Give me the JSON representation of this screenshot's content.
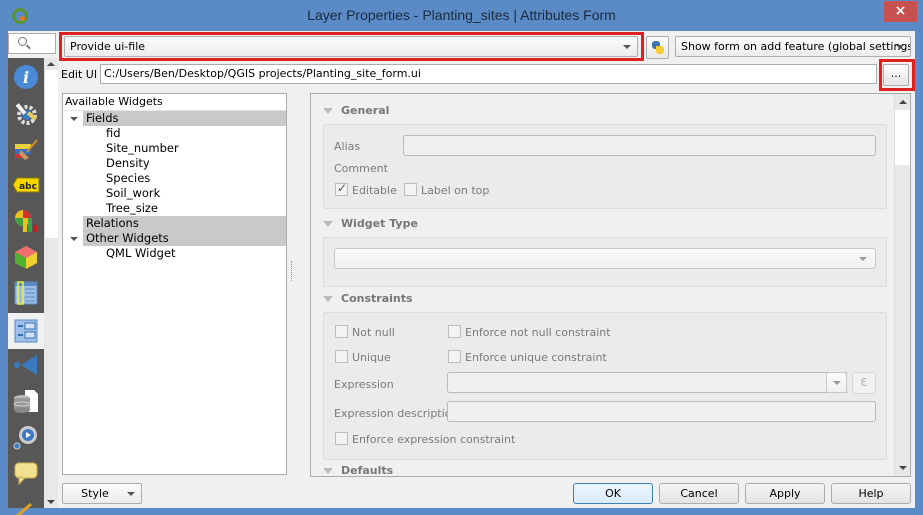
{
  "window": {
    "title": "Layer Properties - Planting_sites | Attributes Form",
    "close_label": "×"
  },
  "sidebar": {
    "search_icon": "search-icon",
    "items": [
      {
        "name": "information",
        "icon": "info-icon"
      },
      {
        "name": "source",
        "icon": "settings-wrench-icon"
      },
      {
        "name": "symbology",
        "icon": "paintbrush-icon"
      },
      {
        "name": "labels",
        "icon": "abc-label-icon"
      },
      {
        "name": "diagrams",
        "icon": "diagram-icon"
      },
      {
        "name": "3d-view",
        "icon": "cube-icon"
      },
      {
        "name": "fields",
        "icon": "fields-table-icon"
      },
      {
        "name": "attributes-form",
        "icon": "form-icon",
        "active": true
      },
      {
        "name": "joins",
        "icon": "join-icon"
      },
      {
        "name": "auxiliary-storage",
        "icon": "database-icon"
      },
      {
        "name": "actions",
        "icon": "action-gear-icon"
      },
      {
        "name": "display",
        "icon": "speech-bubble-icon"
      },
      {
        "name": "rendering",
        "icon": "pencil-icon"
      }
    ]
  },
  "toolbar": {
    "form_type_value": "Provide ui-file",
    "python_button_icon": "python-icon",
    "suppress_value": "Show form on add feature (global settings)",
    "edit_ui_label": "Edit UI",
    "edit_ui_value": "C:/Users/Ben/Desktop/QGIS projects/Planting_site_form.ui",
    "browse_label": "..."
  },
  "widgets_tree": {
    "header": "Available Widgets",
    "groups": [
      {
        "label": "Fields",
        "expanded": true,
        "children": [
          "fid",
          "Site_number",
          "Density",
          "Species",
          "Soil_work",
          "Tree_size"
        ]
      },
      {
        "label": "Relations",
        "expanded": false,
        "children": []
      },
      {
        "label": "Other Widgets",
        "expanded": true,
        "children": [
          "QML Widget"
        ]
      }
    ]
  },
  "properties": {
    "general": {
      "title": "General",
      "alias_label": "Alias",
      "alias_value": "",
      "comment_label": "Comment",
      "editable_label": "Editable",
      "editable_checked": true,
      "label_on_top_label": "Label on top",
      "label_on_top_checked": false
    },
    "widget_type": {
      "title": "Widget Type",
      "value": ""
    },
    "constraints": {
      "title": "Constraints",
      "not_null_label": "Not null",
      "enforce_not_null_label": "Enforce not null constraint",
      "unique_label": "Unique",
      "enforce_unique_label": "Enforce unique constraint",
      "expression_label": "Expression",
      "expression_value": "",
      "expression_button": "ε",
      "expression_description_label": "Expression description",
      "expression_description_value": "",
      "enforce_expression_label": "Enforce expression constraint"
    },
    "defaults": {
      "title": "Defaults"
    }
  },
  "footer": {
    "style_label": "Style",
    "ok_label": "OK",
    "cancel_label": "Cancel",
    "apply_label": "Apply",
    "help_label": "Help"
  },
  "colors": {
    "title_bar": "#5b8bc7",
    "close_button": "#c75050",
    "highlight_frame": "#e0201f",
    "sidebar_bg": "#575757",
    "tree_group_bg": "#c9c9c9"
  }
}
